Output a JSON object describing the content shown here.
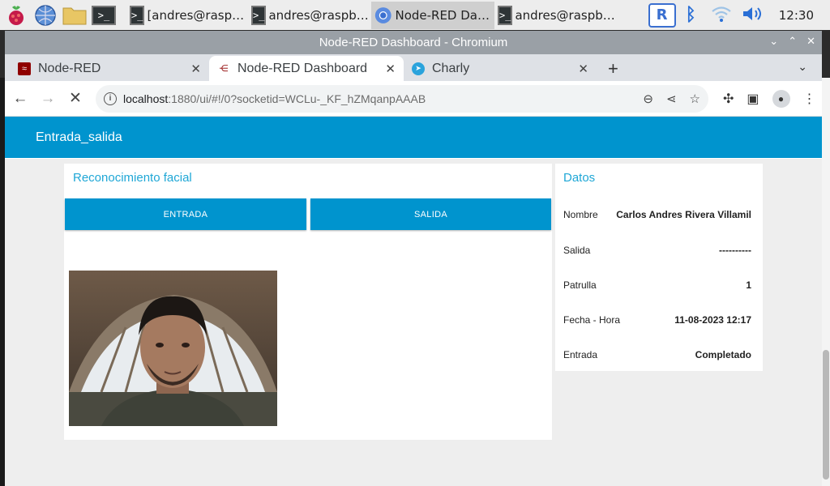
{
  "taskbar": {
    "tasks": [
      {
        "label": "[andres@rasp…",
        "kind": "terminal"
      },
      {
        "label": "andres@raspb…",
        "kind": "terminal"
      },
      {
        "label": "Node-RED Da…",
        "kind": "chromium"
      },
      {
        "label": "andres@raspb…",
        "kind": "terminal"
      }
    ],
    "clock": "12:30"
  },
  "window": {
    "title": "Node-RED Dashboard - Chromium",
    "tabs": [
      {
        "label": "Node-RED",
        "icon": "node-red-icon"
      },
      {
        "label": "Node-RED Dashboard",
        "icon": "node-red-flow-icon"
      },
      {
        "label": "Charly",
        "icon": "telegram-icon"
      }
    ],
    "url_host": "localhost",
    "url_path": ":1880/ui/#!/0?socketid=WCLu-_KF_hZMqanpAAAB"
  },
  "dashboard": {
    "header": "Entrada_salida",
    "left_group": {
      "title": "Reconocimiento facial",
      "buttons": {
        "entrada": "ENTRADA",
        "salida": "SALIDA"
      }
    },
    "right_group": {
      "title": "Datos",
      "rows": [
        {
          "label": "Nombre",
          "value": "Carlos Andres Rivera Villamil"
        },
        {
          "label": "Salida",
          "value": "----------"
        },
        {
          "label": "Patrulla",
          "value": "1"
        },
        {
          "label": "Fecha - Hora",
          "value": "11-08-2023 12:17"
        },
        {
          "label": "Entrada",
          "value": "Completado"
        }
      ]
    }
  },
  "colors": {
    "accent": "#0094ce",
    "title": "#1fa7d6"
  }
}
